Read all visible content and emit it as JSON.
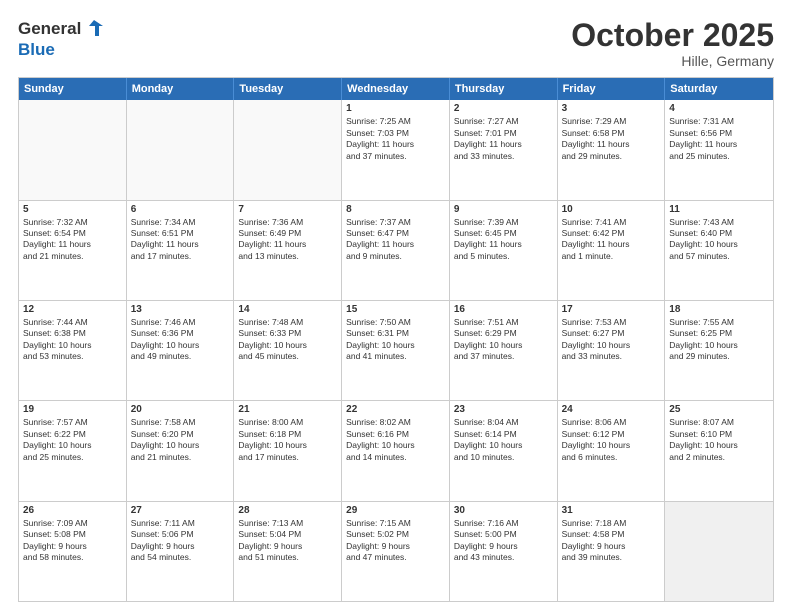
{
  "header": {
    "logo_line1": "General",
    "logo_line2": "Blue",
    "month": "October 2025",
    "location": "Hille, Germany"
  },
  "weekdays": [
    "Sunday",
    "Monday",
    "Tuesday",
    "Wednesday",
    "Thursday",
    "Friday",
    "Saturday"
  ],
  "rows": [
    [
      {
        "day": "",
        "lines": [],
        "empty": true
      },
      {
        "day": "",
        "lines": [],
        "empty": true
      },
      {
        "day": "",
        "lines": [],
        "empty": true
      },
      {
        "day": "1",
        "lines": [
          "Sunrise: 7:25 AM",
          "Sunset: 7:03 PM",
          "Daylight: 11 hours",
          "and 37 minutes."
        ]
      },
      {
        "day": "2",
        "lines": [
          "Sunrise: 7:27 AM",
          "Sunset: 7:01 PM",
          "Daylight: 11 hours",
          "and 33 minutes."
        ]
      },
      {
        "day": "3",
        "lines": [
          "Sunrise: 7:29 AM",
          "Sunset: 6:58 PM",
          "Daylight: 11 hours",
          "and 29 minutes."
        ]
      },
      {
        "day": "4",
        "lines": [
          "Sunrise: 7:31 AM",
          "Sunset: 6:56 PM",
          "Daylight: 11 hours",
          "and 25 minutes."
        ]
      }
    ],
    [
      {
        "day": "5",
        "lines": [
          "Sunrise: 7:32 AM",
          "Sunset: 6:54 PM",
          "Daylight: 11 hours",
          "and 21 minutes."
        ]
      },
      {
        "day": "6",
        "lines": [
          "Sunrise: 7:34 AM",
          "Sunset: 6:51 PM",
          "Daylight: 11 hours",
          "and 17 minutes."
        ]
      },
      {
        "day": "7",
        "lines": [
          "Sunrise: 7:36 AM",
          "Sunset: 6:49 PM",
          "Daylight: 11 hours",
          "and 13 minutes."
        ]
      },
      {
        "day": "8",
        "lines": [
          "Sunrise: 7:37 AM",
          "Sunset: 6:47 PM",
          "Daylight: 11 hours",
          "and 9 minutes."
        ]
      },
      {
        "day": "9",
        "lines": [
          "Sunrise: 7:39 AM",
          "Sunset: 6:45 PM",
          "Daylight: 11 hours",
          "and 5 minutes."
        ]
      },
      {
        "day": "10",
        "lines": [
          "Sunrise: 7:41 AM",
          "Sunset: 6:42 PM",
          "Daylight: 11 hours",
          "and 1 minute."
        ]
      },
      {
        "day": "11",
        "lines": [
          "Sunrise: 7:43 AM",
          "Sunset: 6:40 PM",
          "Daylight: 10 hours",
          "and 57 minutes."
        ]
      }
    ],
    [
      {
        "day": "12",
        "lines": [
          "Sunrise: 7:44 AM",
          "Sunset: 6:38 PM",
          "Daylight: 10 hours",
          "and 53 minutes."
        ]
      },
      {
        "day": "13",
        "lines": [
          "Sunrise: 7:46 AM",
          "Sunset: 6:36 PM",
          "Daylight: 10 hours",
          "and 49 minutes."
        ]
      },
      {
        "day": "14",
        "lines": [
          "Sunrise: 7:48 AM",
          "Sunset: 6:33 PM",
          "Daylight: 10 hours",
          "and 45 minutes."
        ]
      },
      {
        "day": "15",
        "lines": [
          "Sunrise: 7:50 AM",
          "Sunset: 6:31 PM",
          "Daylight: 10 hours",
          "and 41 minutes."
        ]
      },
      {
        "day": "16",
        "lines": [
          "Sunrise: 7:51 AM",
          "Sunset: 6:29 PM",
          "Daylight: 10 hours",
          "and 37 minutes."
        ]
      },
      {
        "day": "17",
        "lines": [
          "Sunrise: 7:53 AM",
          "Sunset: 6:27 PM",
          "Daylight: 10 hours",
          "and 33 minutes."
        ]
      },
      {
        "day": "18",
        "lines": [
          "Sunrise: 7:55 AM",
          "Sunset: 6:25 PM",
          "Daylight: 10 hours",
          "and 29 minutes."
        ]
      }
    ],
    [
      {
        "day": "19",
        "lines": [
          "Sunrise: 7:57 AM",
          "Sunset: 6:22 PM",
          "Daylight: 10 hours",
          "and 25 minutes."
        ]
      },
      {
        "day": "20",
        "lines": [
          "Sunrise: 7:58 AM",
          "Sunset: 6:20 PM",
          "Daylight: 10 hours",
          "and 21 minutes."
        ]
      },
      {
        "day": "21",
        "lines": [
          "Sunrise: 8:00 AM",
          "Sunset: 6:18 PM",
          "Daylight: 10 hours",
          "and 17 minutes."
        ]
      },
      {
        "day": "22",
        "lines": [
          "Sunrise: 8:02 AM",
          "Sunset: 6:16 PM",
          "Daylight: 10 hours",
          "and 14 minutes."
        ]
      },
      {
        "day": "23",
        "lines": [
          "Sunrise: 8:04 AM",
          "Sunset: 6:14 PM",
          "Daylight: 10 hours",
          "and 10 minutes."
        ]
      },
      {
        "day": "24",
        "lines": [
          "Sunrise: 8:06 AM",
          "Sunset: 6:12 PM",
          "Daylight: 10 hours",
          "and 6 minutes."
        ]
      },
      {
        "day": "25",
        "lines": [
          "Sunrise: 8:07 AM",
          "Sunset: 6:10 PM",
          "Daylight: 10 hours",
          "and 2 minutes."
        ]
      }
    ],
    [
      {
        "day": "26",
        "lines": [
          "Sunrise: 7:09 AM",
          "Sunset: 5:08 PM",
          "Daylight: 9 hours",
          "and 58 minutes."
        ]
      },
      {
        "day": "27",
        "lines": [
          "Sunrise: 7:11 AM",
          "Sunset: 5:06 PM",
          "Daylight: 9 hours",
          "and 54 minutes."
        ]
      },
      {
        "day": "28",
        "lines": [
          "Sunrise: 7:13 AM",
          "Sunset: 5:04 PM",
          "Daylight: 9 hours",
          "and 51 minutes."
        ]
      },
      {
        "day": "29",
        "lines": [
          "Sunrise: 7:15 AM",
          "Sunset: 5:02 PM",
          "Daylight: 9 hours",
          "and 47 minutes."
        ]
      },
      {
        "day": "30",
        "lines": [
          "Sunrise: 7:16 AM",
          "Sunset: 5:00 PM",
          "Daylight: 9 hours",
          "and 43 minutes."
        ]
      },
      {
        "day": "31",
        "lines": [
          "Sunrise: 7:18 AM",
          "Sunset: 4:58 PM",
          "Daylight: 9 hours",
          "and 39 minutes."
        ]
      },
      {
        "day": "",
        "lines": [],
        "empty": true,
        "shaded": true
      }
    ]
  ]
}
